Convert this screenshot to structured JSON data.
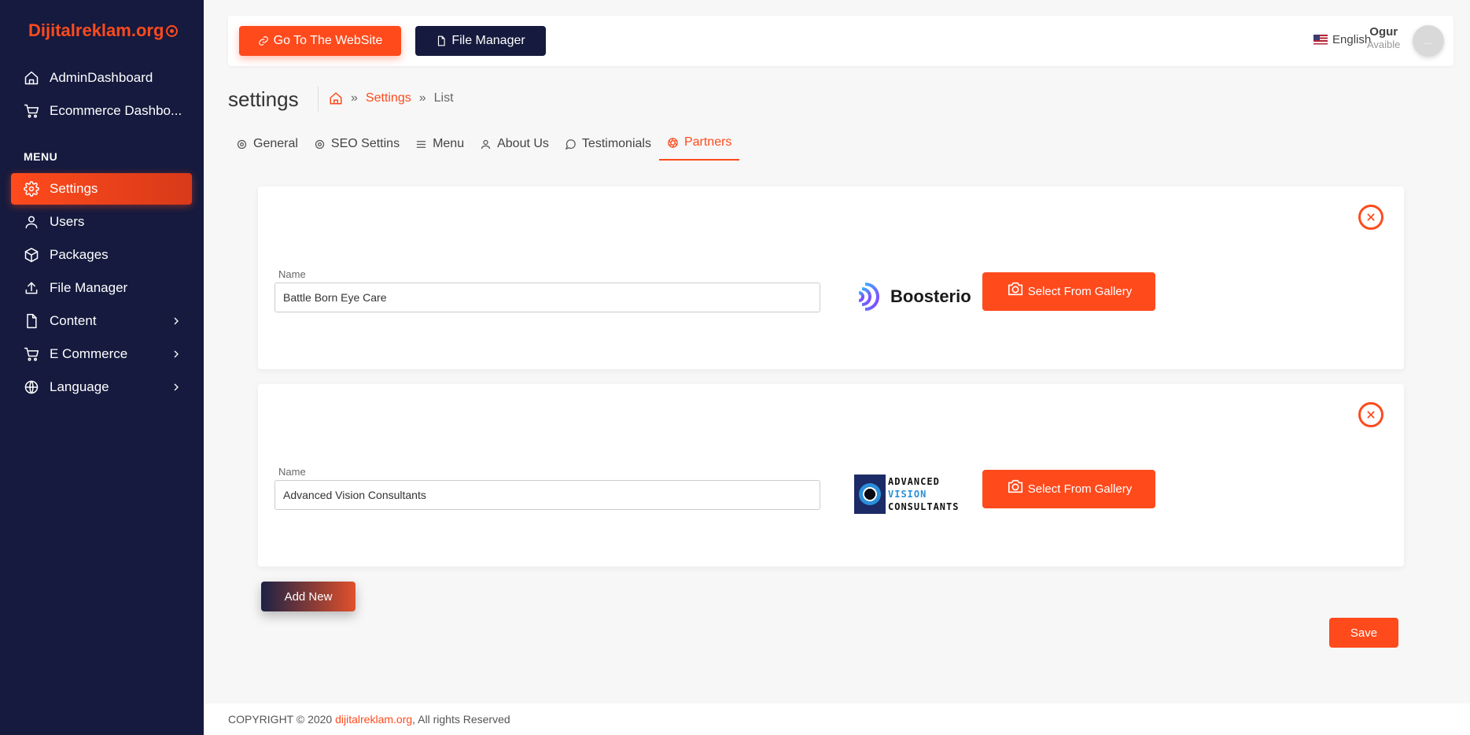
{
  "brand": {
    "name": "Dijitalreklam.org"
  },
  "sidebar": {
    "top_items": [
      {
        "label": "AdminDashboard",
        "icon": "home-icon"
      },
      {
        "label": "Ecommerce Dashbo...",
        "icon": "cart-icon"
      }
    ],
    "section_label": "MENU",
    "menu_items": [
      {
        "label": "Settings",
        "icon": "gear-icon",
        "active": true
      },
      {
        "label": "Users",
        "icon": "user-icon"
      },
      {
        "label": "Packages",
        "icon": "package-icon"
      },
      {
        "label": "File Manager",
        "icon": "upload-icon"
      },
      {
        "label": "Content",
        "icon": "file-icon",
        "has_children": true
      },
      {
        "label": "E Commerce",
        "icon": "cart-icon",
        "has_children": true
      },
      {
        "label": "Language",
        "icon": "globe-icon",
        "has_children": true
      }
    ]
  },
  "topbar": {
    "website_button": "Go To The WebSite",
    "file_manager_button": "File Manager",
    "language": "English",
    "user_name": "Ogur",
    "user_status": "Avaible",
    "avatar_text": "..."
  },
  "page": {
    "title": "settings",
    "breadcrumb": {
      "link": "Settings",
      "current": "List"
    }
  },
  "tabs": [
    {
      "label": "General",
      "icon": "gear-icon"
    },
    {
      "label": "SEO Settins",
      "icon": "gear-icon"
    },
    {
      "label": "Menu",
      "icon": "menu-icon"
    },
    {
      "label": "About Us",
      "icon": "user-icon"
    },
    {
      "label": "Testimonials",
      "icon": "chat-icon"
    },
    {
      "label": "Partners",
      "icon": "aperture-icon",
      "active": true
    }
  ],
  "partners": [
    {
      "name_label": "Name",
      "name_value": "Battle Born Eye Care",
      "logo_text": "Boosterio",
      "gallery_button": "Select From Gallery"
    },
    {
      "name_label": "Name",
      "name_value": "Advanced Vision Consultants",
      "logo_lines": [
        "ADVANCED",
        "VISION",
        "CONSULTANTS"
      ],
      "gallery_button": "Select From Gallery"
    }
  ],
  "actions": {
    "add_new": "Add New",
    "save": "Save"
  },
  "footer": {
    "prefix": "COPYRIGHT © 2020 ",
    "link": "dijitalreklam.org",
    "suffix": ", All rights Reserved"
  },
  "colors": {
    "accent": "#ff4a1c",
    "sidebar_bg": "#151a3e"
  }
}
